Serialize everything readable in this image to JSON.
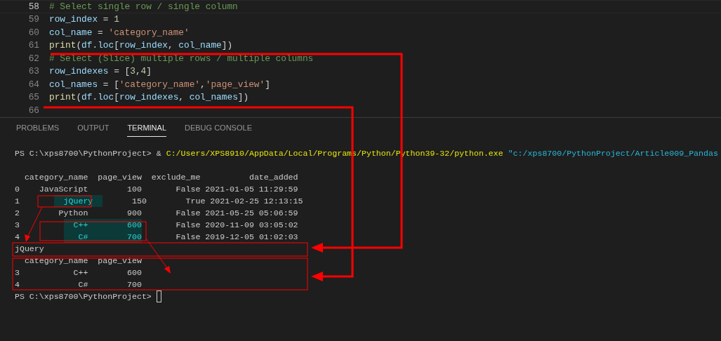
{
  "editor": {
    "lines": [
      {
        "number": "58",
        "current": true,
        "tokens": [
          {
            "kind": "comment",
            "text": "# Select single row / single column"
          }
        ]
      },
      {
        "number": "59",
        "current": false,
        "tokens": [
          {
            "kind": "variable",
            "text": "row_index"
          },
          {
            "kind": "punct",
            "text": " = "
          },
          {
            "kind": "number",
            "text": "1"
          }
        ]
      },
      {
        "number": "60",
        "current": false,
        "tokens": [
          {
            "kind": "variable",
            "text": "col_name"
          },
          {
            "kind": "punct",
            "text": " = "
          },
          {
            "kind": "string",
            "text": "'category_name'"
          }
        ]
      },
      {
        "number": "61",
        "current": false,
        "tokens": [
          {
            "kind": "function",
            "text": "print"
          },
          {
            "kind": "punct",
            "text": "("
          },
          {
            "kind": "variable",
            "text": "df"
          },
          {
            "kind": "punct",
            "text": "."
          },
          {
            "kind": "variable",
            "text": "loc"
          },
          {
            "kind": "punct",
            "text": "["
          },
          {
            "kind": "variable",
            "text": "row_index"
          },
          {
            "kind": "punct",
            "text": ", "
          },
          {
            "kind": "variable",
            "text": "col_name"
          },
          {
            "kind": "punct",
            "text": "])"
          }
        ]
      },
      {
        "number": "62",
        "current": false,
        "tokens": [
          {
            "kind": "comment",
            "text": "# Select (Slice) multiple rows / multiple columns"
          }
        ]
      },
      {
        "number": "63",
        "current": false,
        "tokens": [
          {
            "kind": "variable",
            "text": "row_indexes"
          },
          {
            "kind": "punct",
            "text": " = ["
          },
          {
            "kind": "number",
            "text": "3"
          },
          {
            "kind": "punct",
            "text": ","
          },
          {
            "kind": "number",
            "text": "4"
          },
          {
            "kind": "punct",
            "text": "]"
          }
        ]
      },
      {
        "number": "64",
        "current": false,
        "tokens": [
          {
            "kind": "variable",
            "text": "col_names"
          },
          {
            "kind": "punct",
            "text": " = ["
          },
          {
            "kind": "string",
            "text": "'category_name'"
          },
          {
            "kind": "punct",
            "text": ","
          },
          {
            "kind": "string",
            "text": "'page_view'"
          },
          {
            "kind": "punct",
            "text": "]"
          }
        ]
      },
      {
        "number": "65",
        "current": false,
        "tokens": [
          {
            "kind": "function",
            "text": "print"
          },
          {
            "kind": "punct",
            "text": "("
          },
          {
            "kind": "variable",
            "text": "df"
          },
          {
            "kind": "punct",
            "text": "."
          },
          {
            "kind": "variable",
            "text": "loc"
          },
          {
            "kind": "punct",
            "text": "["
          },
          {
            "kind": "variable",
            "text": "row_indexes"
          },
          {
            "kind": "punct",
            "text": ", "
          },
          {
            "kind": "variable",
            "text": "col_names"
          },
          {
            "kind": "punct",
            "text": "])"
          }
        ]
      },
      {
        "number": "66",
        "current": false
      }
    ]
  },
  "panel_tabs": [
    {
      "label": "PROBLEMS",
      "selected": false
    },
    {
      "label": "OUTPUT",
      "selected": false
    },
    {
      "label": "TERMINAL",
      "selected": true
    },
    {
      "label": "DEBUG CONSOLE",
      "selected": false
    }
  ],
  "terminal": {
    "lines": [
      [
        {
          "kind": "prompt",
          "text": "PS C:\\xps8700\\PythonProject> "
        },
        {
          "kind": "plain",
          "text": "& "
        },
        {
          "kind": "path",
          "text": "C:/Users/XPS8910/AppData/Local/Programs/Python/Python39-32/python.exe"
        },
        {
          "kind": "arg",
          "text": " \"c:/xps8700/PythonProject/Article009_Pandas"
        }
      ],
      [
        {
          "kind": "plain",
          "text": "  category_name  page_view  exclude_me          date_added"
        }
      ],
      [
        {
          "kind": "plain",
          "text": "0    JavaScript        100       False 2021-01-05 11:29:59"
        }
      ],
      [
        {
          "kind": "plain",
          "text": "1       "
        },
        {
          "kind": "match",
          "text": "  jQuery  "
        },
        {
          "kind": "plain",
          "text": "      150        True 2021-02-25 12:13:15"
        }
      ],
      [
        {
          "kind": "plain",
          "text": "2        Python        900       False 2021-05-25 05:06:59"
        }
      ],
      [
        {
          "kind": "plain",
          "text": "3         "
        },
        {
          "kind": "match",
          "text": "  C++        600"
        },
        {
          "kind": "plain",
          "text": "       False 2020-11-09 03:05:02"
        }
      ],
      [
        {
          "kind": "plain",
          "text": "4         "
        },
        {
          "kind": "match",
          "text": "   C#        700"
        },
        {
          "kind": "plain",
          "text": "       False 2019-12-05 01:02:03"
        }
      ],
      [
        {
          "kind": "plain",
          "text": "jQuery"
        }
      ],
      [
        {
          "kind": "plain",
          "text": "  category_name  page_view"
        }
      ],
      [
        {
          "kind": "plain",
          "text": "3           C++        600"
        }
      ],
      [
        {
          "kind": "plain",
          "text": "4            C#        700"
        }
      ],
      [
        {
          "kind": "prompt",
          "text": "PS C:\\xps8700\\PythonProject> "
        }
      ]
    ]
  }
}
